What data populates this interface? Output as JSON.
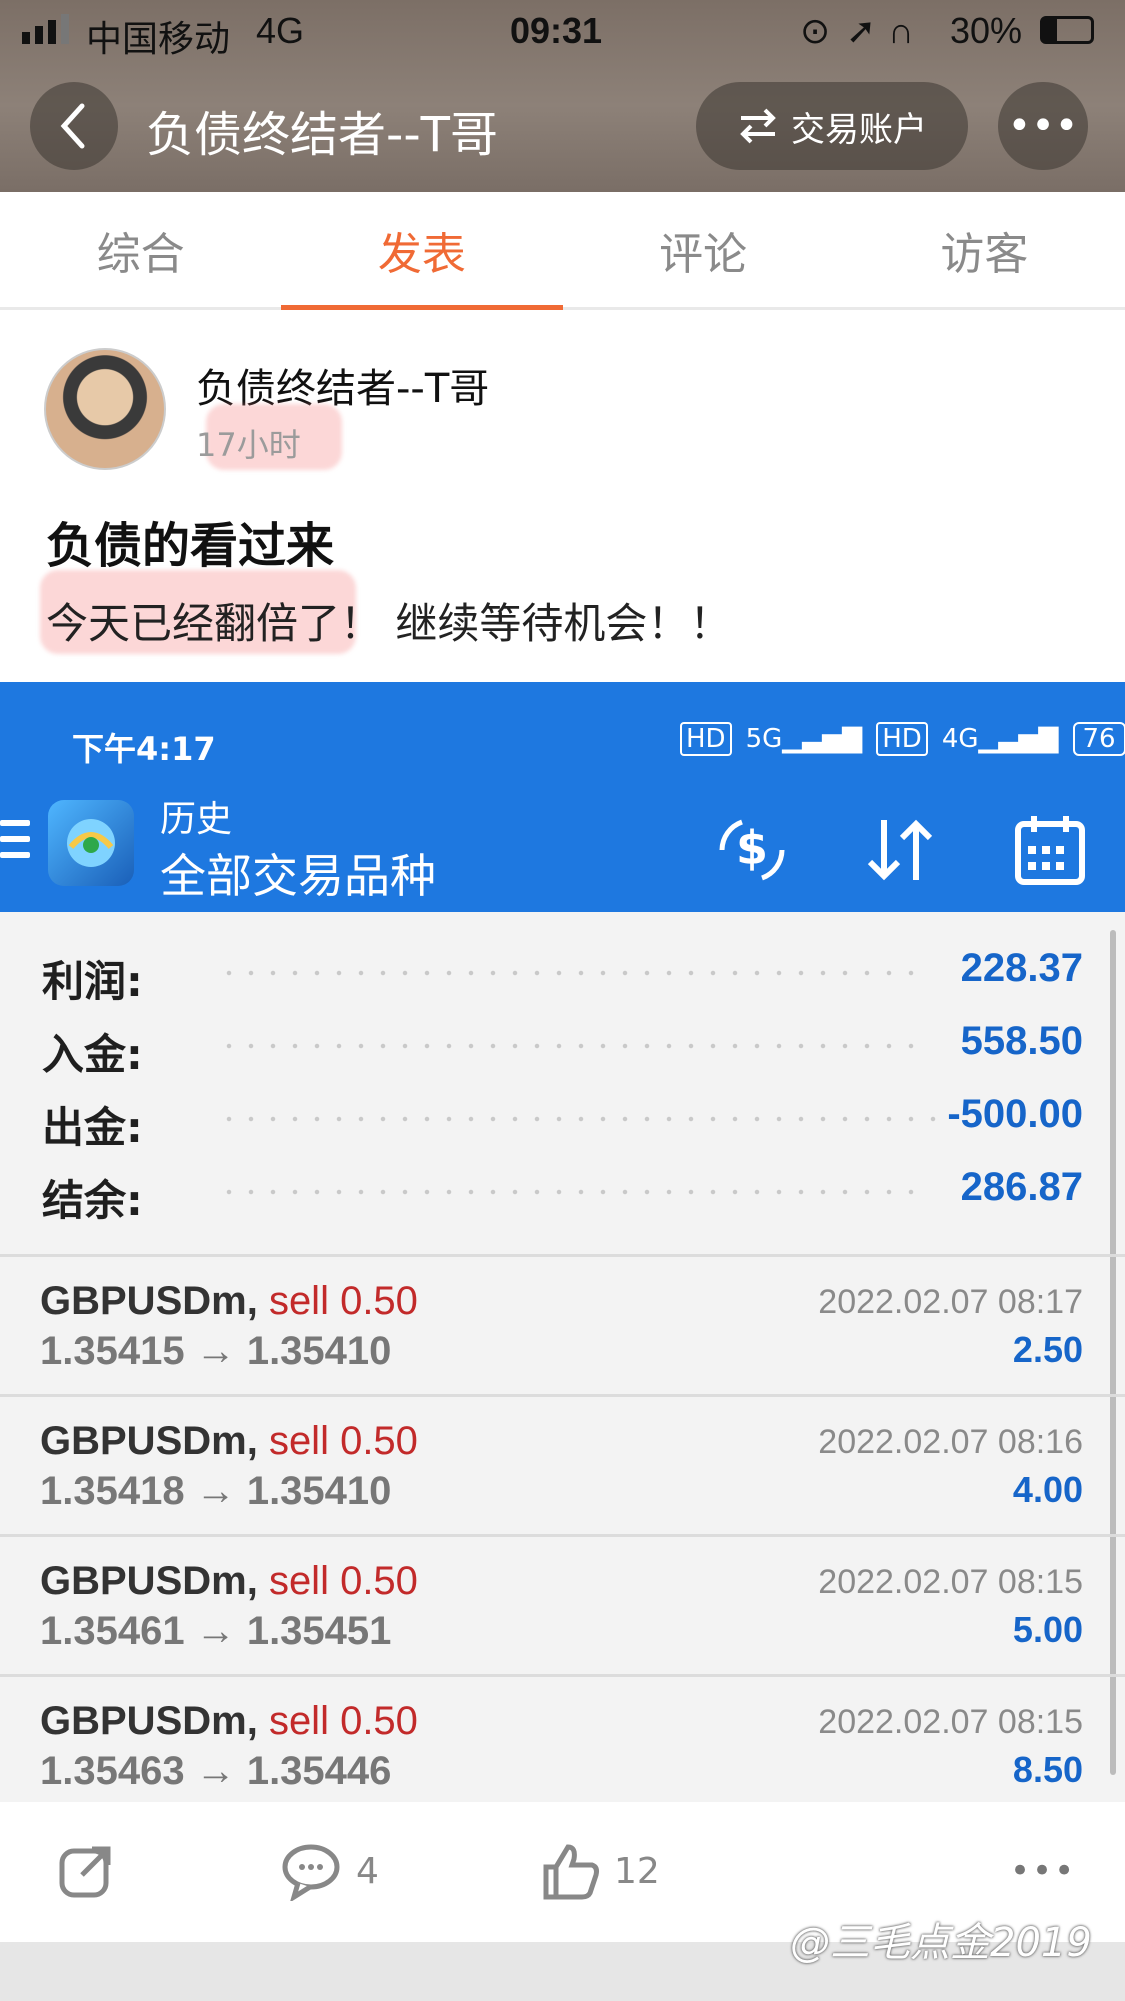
{
  "status_bar": {
    "carrier": "中国移动",
    "network": "4G",
    "time": "09:31",
    "battery": "30%"
  },
  "header": {
    "title": "负债终结者--T哥",
    "account_button": "交易账户"
  },
  "tabs": [
    {
      "label": "综合",
      "active": false
    },
    {
      "label": "发表",
      "active": true
    },
    {
      "label": "评论",
      "active": false
    },
    {
      "label": "访客",
      "active": false
    }
  ],
  "post": {
    "author": "负债终结者--T哥",
    "time": "17小时",
    "title": "负债的看过来",
    "body": "今天已经翻倍了！ 继续等待机会！！"
  },
  "screenshot": {
    "status_time": "下午4:17",
    "status_battery": "76",
    "history_label": "历史",
    "title": "全部交易品种",
    "summary": [
      {
        "label": "利润:",
        "value": "228.37"
      },
      {
        "label": "入金:",
        "value": "558.50"
      },
      {
        "label": "出金:",
        "value": "-500.00"
      },
      {
        "label": "结余:",
        "value": "286.87"
      }
    ],
    "trades": [
      {
        "symbol": "GBPUSDm,",
        "side": "sell 0.50",
        "prices": "1.35415 → 1.35410",
        "time": "2022.02.07 08:17",
        "pl": "2.50"
      },
      {
        "symbol": "GBPUSDm,",
        "side": "sell 0.50",
        "prices": "1.35418 → 1.35410",
        "time": "2022.02.07 08:16",
        "pl": "4.00"
      },
      {
        "symbol": "GBPUSDm,",
        "side": "sell 0.50",
        "prices": "1.35461 → 1.35451",
        "time": "2022.02.07 08:15",
        "pl": "5.00"
      },
      {
        "symbol": "GBPUSDm,",
        "side": "sell 0.50",
        "prices": "1.35463 → 1.35446",
        "time": "2022.02.07 08:15",
        "pl": "8.50"
      }
    ]
  },
  "footer": {
    "comment_count": "4",
    "like_count": "12"
  },
  "watermark": "@三毛点金2019",
  "colors": {
    "accent": "#f06a35",
    "mt_blue": "#1e78e0",
    "value_blue": "#1665c9",
    "sell_red": "#c22a2a"
  },
  "icons": [
    "back-icon",
    "swap-icon",
    "more-icon",
    "share-icon",
    "comment-icon",
    "like-icon",
    "menu-icon",
    "currency-exchange-icon",
    "sort-icon",
    "calendar-icon"
  ]
}
